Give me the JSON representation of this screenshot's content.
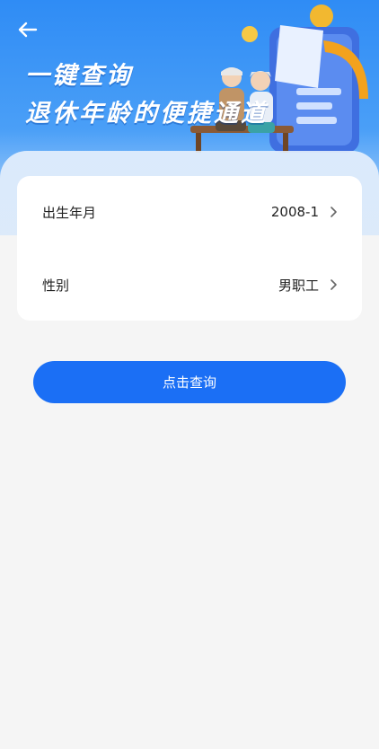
{
  "header": {
    "title_line1": "一键查询",
    "title_line2": "退休年龄的便捷通道",
    "back_icon": "arrow-left-icon"
  },
  "form": {
    "birth_label": "出生年月",
    "birth_value": "2008-1",
    "gender_label": "性别",
    "gender_value": "男职工",
    "chevron_icon": "chevron-right-icon"
  },
  "actions": {
    "query_label": "点击查询"
  },
  "colors": {
    "primary": "#1b6ff5",
    "banner_top": "#2f8cf5",
    "page_bg": "#f5f5f5"
  }
}
